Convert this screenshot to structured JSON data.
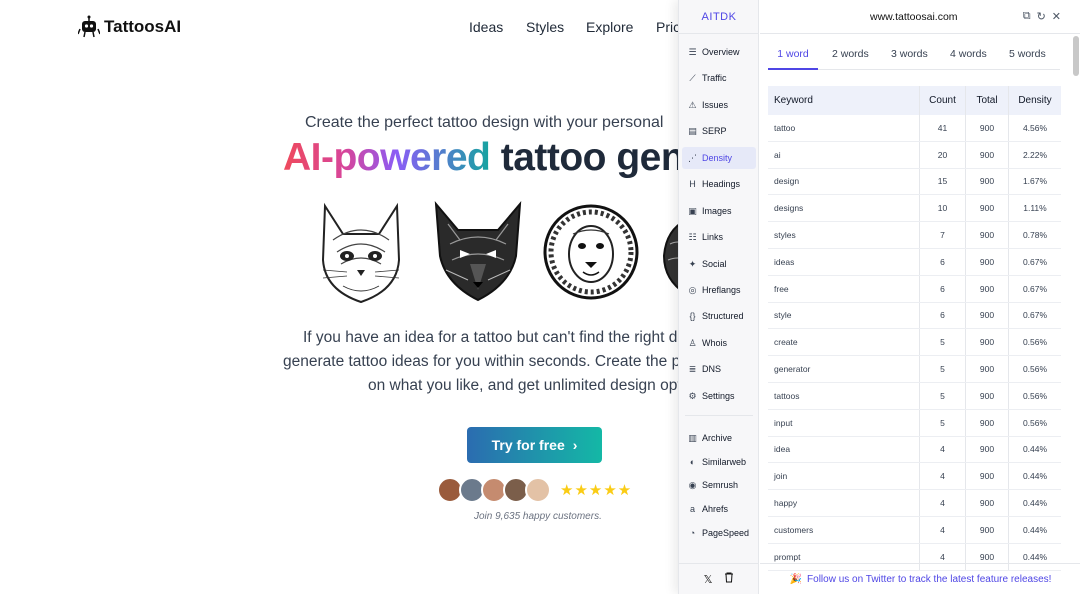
{
  "site": {
    "brand": "TattoosAI",
    "nav": [
      "Ideas",
      "Styles",
      "Explore",
      "Prici"
    ],
    "hero": {
      "subtitle": "Create the perfect tattoo design with your personal",
      "title_gradient": "AI-powered",
      "title_dark": "tattoo gen",
      "description": [
        "If you have an idea for a tattoo but can't find the right des",
        "generate tattoo ideas for you within seconds. Create the perfe",
        "on what you like, and get unlimited design optic"
      ],
      "cta": "Try for free",
      "rating_stars": 5,
      "join_text": "Join 9,635 happy customers."
    },
    "tattoos": [
      "cat",
      "wolf",
      "lion",
      "partial"
    ],
    "avatars": 5,
    "colors": {
      "cta_start": "#2b6cb0",
      "cta_end": "#14b8a6",
      "star": "#facc15"
    }
  },
  "panel": {
    "brand": "AITDK",
    "url": "www.tattoosai.com",
    "sidebar": [
      {
        "label": "Overview",
        "icon": "list-icon"
      },
      {
        "label": "Traffic",
        "icon": "chart-icon"
      },
      {
        "label": "Issues",
        "icon": "warning-icon"
      },
      {
        "label": "SERP",
        "icon": "serp-icon"
      },
      {
        "label": "Density",
        "icon": "density-icon",
        "active": true
      },
      {
        "label": "Headings",
        "icon": "heading-icon"
      },
      {
        "label": "Images",
        "icon": "image-icon"
      },
      {
        "label": "Links",
        "icon": "links-icon"
      },
      {
        "label": "Social",
        "icon": "bird-icon"
      },
      {
        "label": "Hreflangs",
        "icon": "globe-icon"
      },
      {
        "label": "Structured",
        "icon": "braces-icon"
      },
      {
        "label": "Whois",
        "icon": "user-search-icon"
      },
      {
        "label": "DNS",
        "icon": "server-icon"
      },
      {
        "label": "Settings",
        "icon": "gear-icon"
      }
    ],
    "sidebar_tools": [
      {
        "label": "Archive",
        "icon": "archive-icon"
      },
      {
        "label": "Similarweb",
        "icon": "similarweb-icon"
      },
      {
        "label": "Semrush",
        "icon": "semrush-icon"
      },
      {
        "label": "Ahrefs",
        "icon": "ahrefs-icon"
      },
      {
        "label": "PageSpeed",
        "icon": "pagespeed-icon"
      }
    ],
    "tabs": [
      "1 word",
      "2 words",
      "3 words",
      "4 words",
      "5 words"
    ],
    "active_tab": 0,
    "table": {
      "headers": [
        "Keyword",
        "Count",
        "Total",
        "Density"
      ],
      "rows": [
        [
          "tattoo",
          "41",
          "900",
          "4.56%"
        ],
        [
          "ai",
          "20",
          "900",
          "2.22%"
        ],
        [
          "design",
          "15",
          "900",
          "1.67%"
        ],
        [
          "designs",
          "10",
          "900",
          "1.11%"
        ],
        [
          "styles",
          "7",
          "900",
          "0.78%"
        ],
        [
          "ideas",
          "6",
          "900",
          "0.67%"
        ],
        [
          "free",
          "6",
          "900",
          "0.67%"
        ],
        [
          "style",
          "6",
          "900",
          "0.67%"
        ],
        [
          "create",
          "5",
          "900",
          "0.56%"
        ],
        [
          "generator",
          "5",
          "900",
          "0.56%"
        ],
        [
          "tattoos",
          "5",
          "900",
          "0.56%"
        ],
        [
          "input",
          "5",
          "900",
          "0.56%"
        ],
        [
          "idea",
          "4",
          "900",
          "0.44%"
        ],
        [
          "join",
          "4",
          "900",
          "0.44%"
        ],
        [
          "happy",
          "4",
          "900",
          "0.44%"
        ],
        [
          "customers",
          "4",
          "900",
          "0.44%"
        ],
        [
          "prompt",
          "4",
          "900",
          "0.44%"
        ]
      ]
    },
    "footer_text": "Follow us on Twitter to track the latest feature releases!",
    "accent": "#4f46e5"
  }
}
